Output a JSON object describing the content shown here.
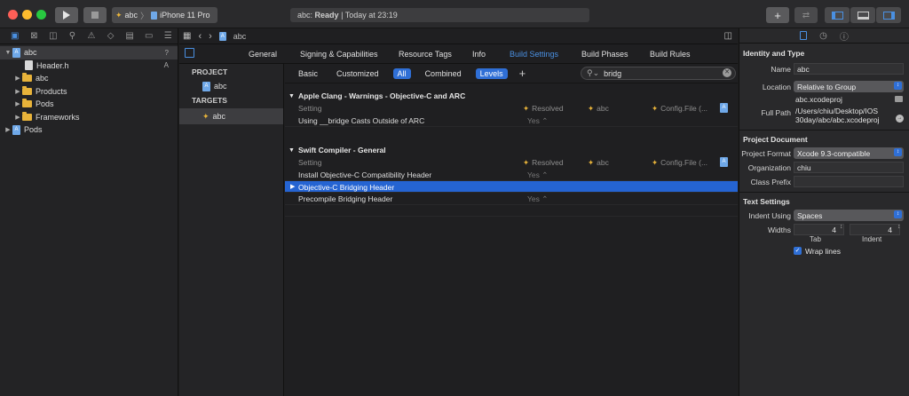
{
  "toolbar": {
    "scheme_target": "abc",
    "scheme_device": "iPhone 11 Pro",
    "activity_project": "abc:",
    "activity_status": "Ready",
    "activity_time": "| Today at 23:19"
  },
  "navigator": {
    "items": [
      {
        "label": "abc",
        "status": "?"
      },
      {
        "label": "Header.h",
        "status": "A"
      },
      {
        "label": "abc",
        "status": ""
      },
      {
        "label": "Products",
        "status": ""
      },
      {
        "label": "Pods",
        "status": ""
      },
      {
        "label": "Frameworks",
        "status": ""
      },
      {
        "label": "Pods",
        "status": ""
      }
    ]
  },
  "editor": {
    "breadcrumb": "abc",
    "tabs": [
      "General",
      "Signing & Capabilities",
      "Resource Tags",
      "Info",
      "Build Settings",
      "Build Phases",
      "Build Rules"
    ],
    "project_header": "PROJECT",
    "project_item": "abc",
    "targets_header": "TARGETS",
    "target_item": "abc",
    "filters": [
      "Basic",
      "Customized",
      "All",
      "Combined",
      "Levels"
    ],
    "add": "+",
    "search_value": "bridg",
    "columns": {
      "setting": "Setting",
      "resolved": "Resolved",
      "abc": "abc",
      "config": "Config.File (..."
    },
    "groups": [
      {
        "title": "Apple Clang - Warnings - Objective-C and ARC",
        "rows": [
          {
            "name": "Using __bridge Casts Outside of ARC",
            "value": "Yes ⌃"
          }
        ]
      },
      {
        "title": "Swift Compiler - General",
        "rows": [
          {
            "name": "Install Objective-C Compatibility Header",
            "value": "Yes ⌃"
          },
          {
            "name": "Objective-C Bridging Header",
            "value": ""
          },
          {
            "name": "Precompile Bridging Header",
            "value": "Yes ⌃"
          }
        ]
      }
    ]
  },
  "inspector": {
    "identity_header": "Identity and Type",
    "name_label": "Name",
    "name_value": "abc",
    "location_label": "Location",
    "location_value": "Relative to Group",
    "location_file": "abc.xcodeproj",
    "fullpath_label": "Full Path",
    "fullpath_line1": "/Users/chiu/Desktop/IOS",
    "fullpath_line2": "30day/abc/abc.xcodeproj",
    "projdoc_header": "Project Document",
    "format_label": "Project Format",
    "format_value": "Xcode 9.3-compatible",
    "org_label": "Organization",
    "org_value": "chiu",
    "prefix_label": "Class Prefix",
    "prefix_value": "",
    "text_header": "Text Settings",
    "indent_label": "Indent Using",
    "indent_value": "Spaces",
    "widths_label": "Widths",
    "tab_value": "4",
    "indent_width_value": "4",
    "tab_caption": "Tab",
    "indent_caption": "Indent",
    "wrap_label": "Wrap lines"
  }
}
